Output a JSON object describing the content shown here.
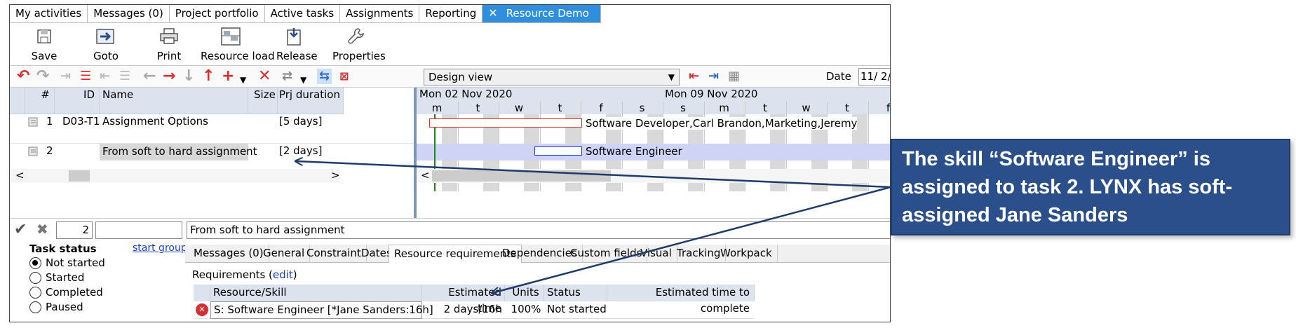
{
  "tabs": [
    {
      "label": "My activities"
    },
    {
      "label": "Messages (0)"
    },
    {
      "label": "Project portfolio"
    },
    {
      "label": "Active tasks"
    },
    {
      "label": "Assignments"
    },
    {
      "label": "Reporting"
    },
    {
      "label": "Resource Demo",
      "active": true,
      "close": "✕"
    }
  ],
  "ribbon": {
    "save": "Save",
    "goto": "Goto",
    "print": "Print",
    "resource_load": "Resource load",
    "release": "Release",
    "properties": "Properties"
  },
  "toolbar": {
    "view_select": "Design view",
    "date_label": "Date",
    "date_value": "11/  2/"
  },
  "grid": {
    "headers": {
      "num": "#",
      "id": "ID",
      "name": "Name",
      "size": "Size",
      "duration": "Prj duration"
    },
    "rows": [
      {
        "num": "1",
        "id": "D03-T1",
        "name": "Assignment Options",
        "size": "",
        "duration": "[5 days]"
      },
      {
        "num": "2",
        "id": "",
        "name": "From soft to hard assignment",
        "size": "",
        "duration": "[2 days]"
      }
    ],
    "scroll_left": "<",
    "scroll_right": ">"
  },
  "gantt": {
    "week1": "Mon 02 Nov 2020",
    "week2": "Mon 09 Nov 2020",
    "days": [
      "m",
      "t",
      "w",
      "t",
      "f",
      "s",
      "s",
      "m",
      "t",
      "w",
      "t",
      "f"
    ],
    "bar1_label": "Software Developer,Carl Brandon,Marketing,Jeremy",
    "bar2_label": "Software Engineer",
    "scroll_left": "<"
  },
  "detail": {
    "num_value": "2",
    "name_value": "From soft to hard assignment",
    "task_status_label": "Task status",
    "start_group": "start group",
    "statuses": [
      {
        "label": "Not started",
        "checked": true
      },
      {
        "label": "Started",
        "checked": false
      },
      {
        "label": "Completed",
        "checked": false
      },
      {
        "label": "Paused",
        "checked": false
      }
    ],
    "tabs": [
      "Messages (0)",
      "General",
      "Constraint",
      "Dates",
      "Resource requirements",
      "Dependencies",
      "Custom fields",
      "Visual",
      "Tracking",
      "Workpack"
    ],
    "requirements_label": "Requirements (",
    "requirements_edit": "edit",
    "requirements_close": ")",
    "req_headers": {
      "resource": "Resource/Skill",
      "estimated": "Estimated time",
      "units": "Units",
      "status": "Status",
      "etc": "Estimated time to complete"
    },
    "req_row": {
      "resource": "S: Software Engineer [*Jane Sanders:16h]",
      "estimated": "2 days/16h",
      "units": "100%",
      "status": "Not started",
      "etc": ""
    }
  },
  "callout": {
    "text": "The skill “Software Engineer”  is assigned to task 2. LYNX has soft-assigned Jane Sanders"
  },
  "colors": {
    "accent_tab": "#2f8fde",
    "callout_bg": "#2b4f8b",
    "arrow": "#1f3b6a",
    "bar1_border": "#d03030",
    "bar2_border": "#1f3bd6",
    "row_highlight": "#cfd3f5"
  }
}
